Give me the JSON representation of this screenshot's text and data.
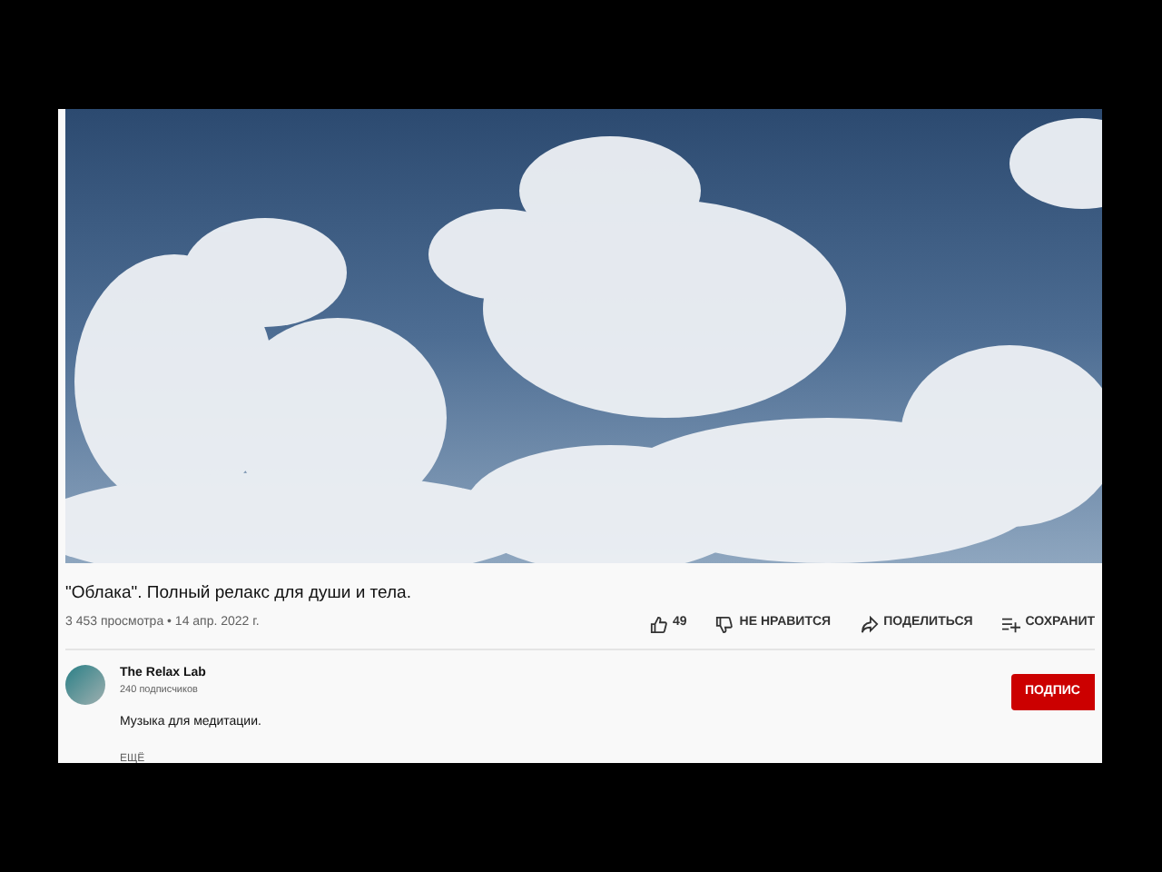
{
  "video": {
    "title": "\"Облака\". Полный релакс для души и тела.",
    "meta": "3 453 просмотра • 14 апр. 2022 г."
  },
  "actions": [
    {
      "kind": "like",
      "label": "49"
    },
    {
      "kind": "dislike",
      "label": "НЕ НРАВИТСЯ"
    },
    {
      "kind": "share",
      "label": "ПОДЕЛИТЬСЯ"
    },
    {
      "kind": "save",
      "label": "СОХРАНИТ"
    }
  ],
  "channel": {
    "name": "The Relax Lab",
    "subscribers": "240 подписчиков",
    "subscribe_button": "ПОДПИС"
  },
  "description": {
    "text": "Музыка для медитации.",
    "more": "ЕЩЁ"
  }
}
